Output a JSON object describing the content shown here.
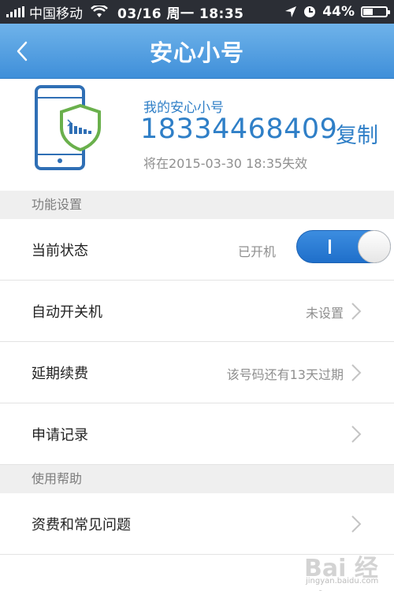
{
  "status_bar": {
    "carrier": "中国移动",
    "time": "03/16 周一 18:35",
    "battery_percent": 44,
    "battery_text": "44%"
  },
  "nav": {
    "title": "安心小号"
  },
  "number_card": {
    "label": "我的安心小号",
    "number": "18334468409",
    "copy_label": "复制",
    "expire_text": "将在2015-03-30 18:35失效"
  },
  "sections": {
    "settings": "功能设置",
    "help": "使用帮助"
  },
  "rows": {
    "status": {
      "label": "当前状态",
      "value": "已开机",
      "toggle_on": true,
      "toggle_text": "I"
    },
    "auto_power": {
      "label": "自动开关机",
      "value": "未设置"
    },
    "renew": {
      "label": "延期续费",
      "value": "该号码还有13天过期"
    },
    "records": {
      "label": "申请记录"
    },
    "faq": {
      "label": "资费和常见问题"
    }
  },
  "watermark": {
    "brand": "Bai 经验",
    "url": "jingyan.baidu.com"
  },
  "colors": {
    "accent": "#2f7fc7",
    "nav_top": "#6fb3ea",
    "nav_bottom": "#3f8fd9",
    "status_bar": "#2b2e35",
    "shield_green": "#6ab04c"
  }
}
